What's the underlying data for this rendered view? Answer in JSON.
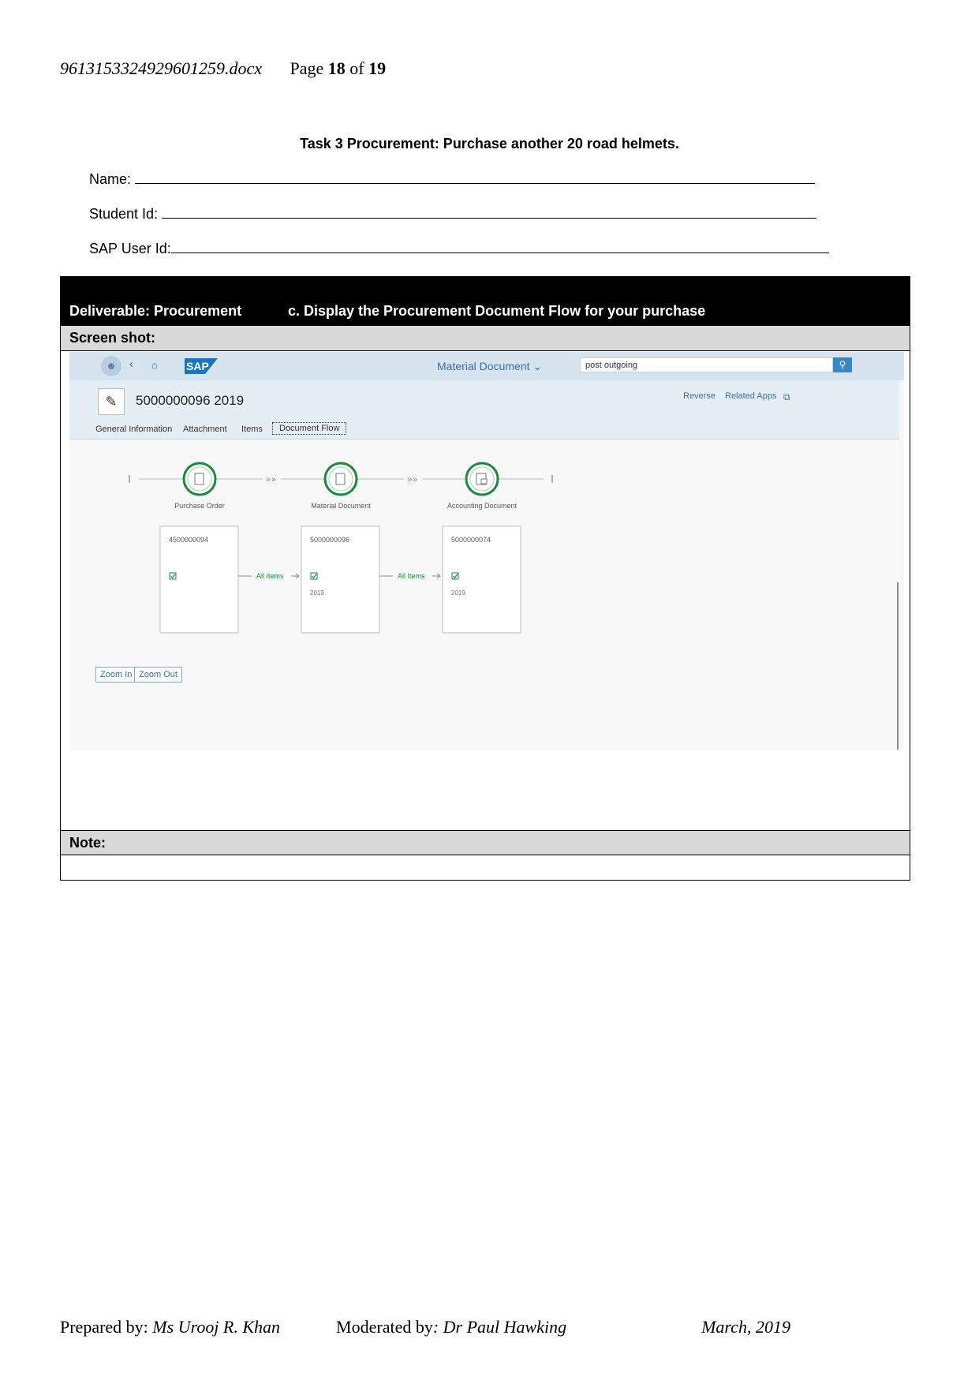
{
  "header": {
    "filename": "9613153324929601259.docx",
    "page_label": "Page",
    "page_current": "18",
    "page_of": "of",
    "page_total": "19"
  },
  "task_title": "Task 3 Procurement: Purchase another 20 road helmets.",
  "fields": [
    {
      "label": "Name: "
    },
    {
      "label": "Student Id: "
    },
    {
      "label": "SAP User Id:"
    }
  ],
  "deliverable": {
    "label": "Deliverable: Procurement",
    "task": "c. Display the Procurement Document Flow for your purchase",
    "screenshot_label": "Screen shot:",
    "note_label": "Note:"
  },
  "sap": {
    "app_title": "Material Document",
    "search_value": "post outgoing",
    "logo_text": "SAP",
    "object_title": "5000000096 2019",
    "header_links": [
      "Reverse",
      "Related Apps"
    ],
    "tabs": [
      "General Information",
      "Attachment",
      "Items",
      "Document Flow"
    ],
    "active_tab": "Document Flow",
    "flow_nodes": [
      {
        "label": "Purchase Order",
        "doc_number": "4500000094",
        "year": ""
      },
      {
        "label": "Material Document",
        "doc_number": "5000000096",
        "year": "2019"
      },
      {
        "label": "Accounting Document",
        "doc_number": "5000000074",
        "year": "2019"
      }
    ],
    "connector_label": "All Items",
    "zoom_in": "Zoom In",
    "zoom_out": "Zoom Out",
    "colors": {
      "node_green": "#1a8a3e",
      "link_blue": "#3a6e9c",
      "shell_bg": "#d6e4ef"
    }
  },
  "footer": {
    "prepared_label": "Prepared by: ",
    "prepared_by": "Ms Urooj R. Khan",
    "moderated_label": "Moderated by",
    "moderated_by": ": Dr Paul Hawking",
    "date": "March, 2019"
  }
}
